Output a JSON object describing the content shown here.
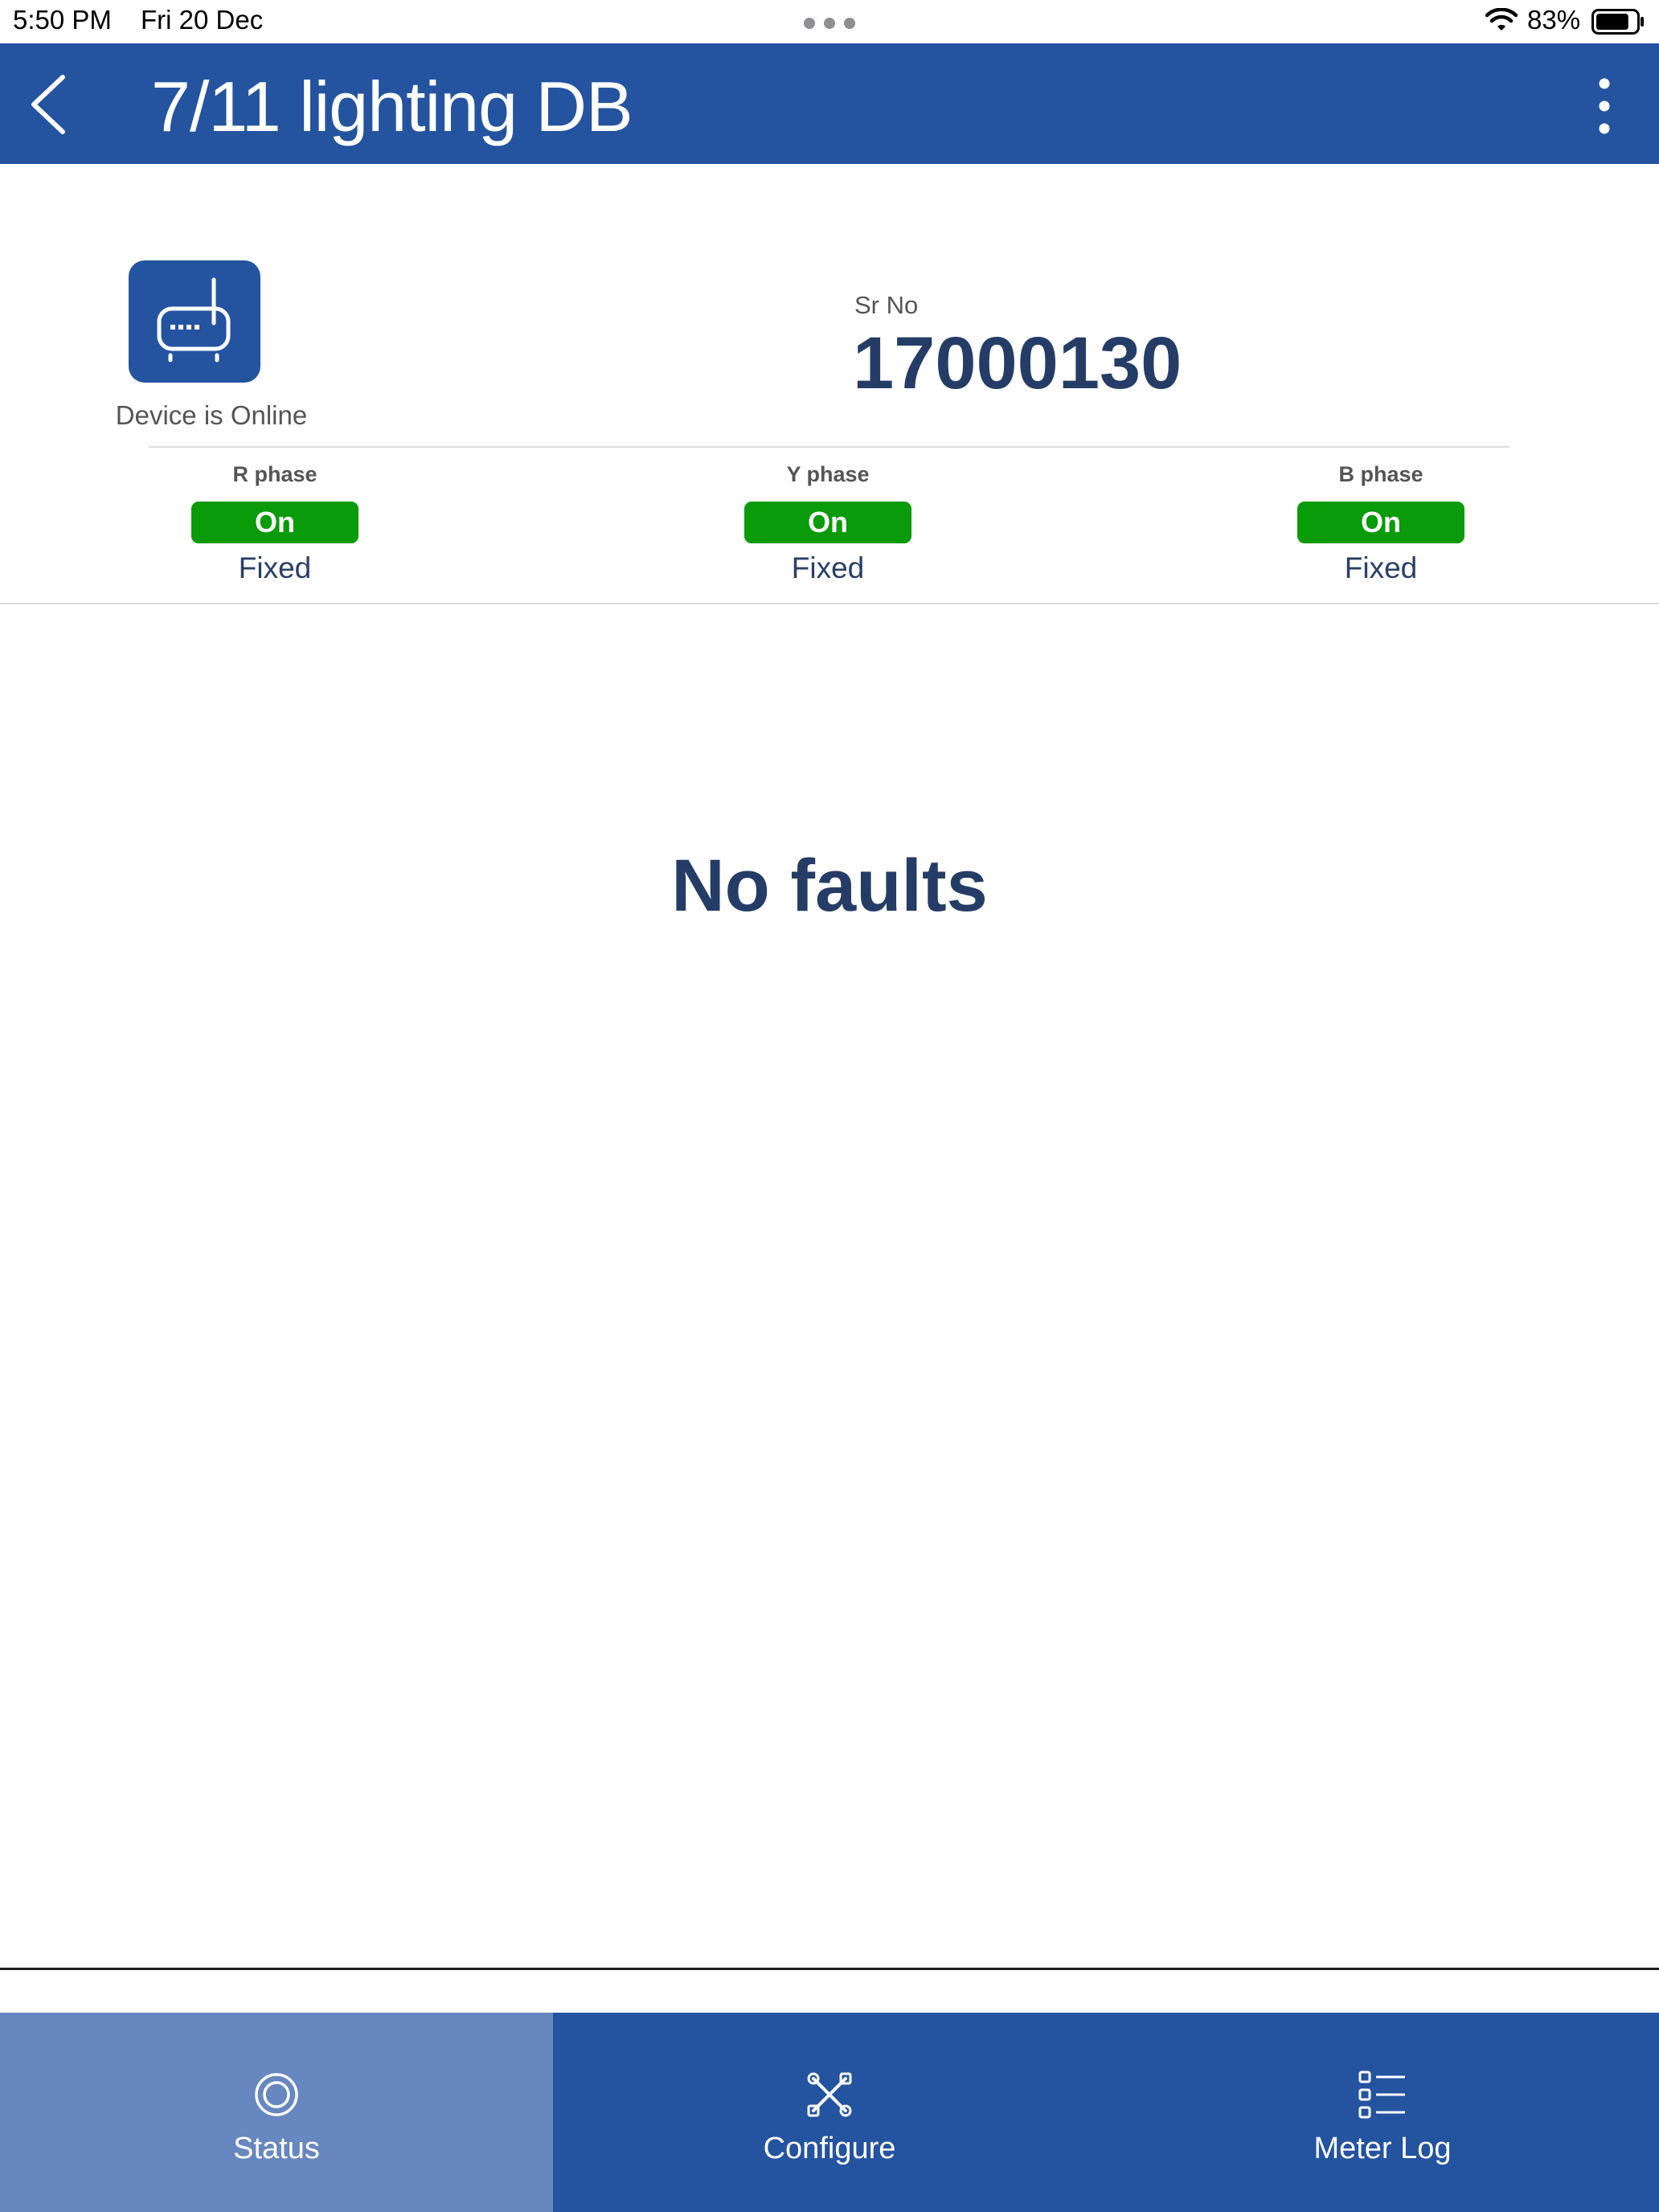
{
  "status_bar": {
    "time": "5:50 PM",
    "date": "Fri 20 Dec",
    "battery_percent": "83%",
    "battery_level": 0.83,
    "icons": [
      "multitask-dots-icon",
      "wifi-icon",
      "battery-icon"
    ]
  },
  "header": {
    "title": "7/11 lighting DB",
    "back_icon": "chevron-left-icon",
    "menu_icon": "more-vertical-icon"
  },
  "device": {
    "icon": "router-icon",
    "status_text": "Device is Online",
    "sr_label": "Sr No",
    "sr_value": "17000130"
  },
  "phases": [
    {
      "label": "R phase",
      "state": "On",
      "mode": "Fixed"
    },
    {
      "label": "Y phase",
      "state": "On",
      "mode": "Fixed"
    },
    {
      "label": "B phase",
      "state": "On",
      "mode": "Fixed"
    }
  ],
  "main": {
    "message": "No faults"
  },
  "tabs": [
    {
      "label": "Status",
      "icon": "target-icon",
      "active": true
    },
    {
      "label": "Configure",
      "icon": "tools-icon",
      "active": false
    },
    {
      "label": "Meter Log",
      "icon": "list-icon",
      "active": false
    }
  ],
  "colors": {
    "primary": "#2453a0",
    "tab_active": "#6687bf",
    "on_badge": "#0a9b0a",
    "title_text": "#253d66"
  }
}
